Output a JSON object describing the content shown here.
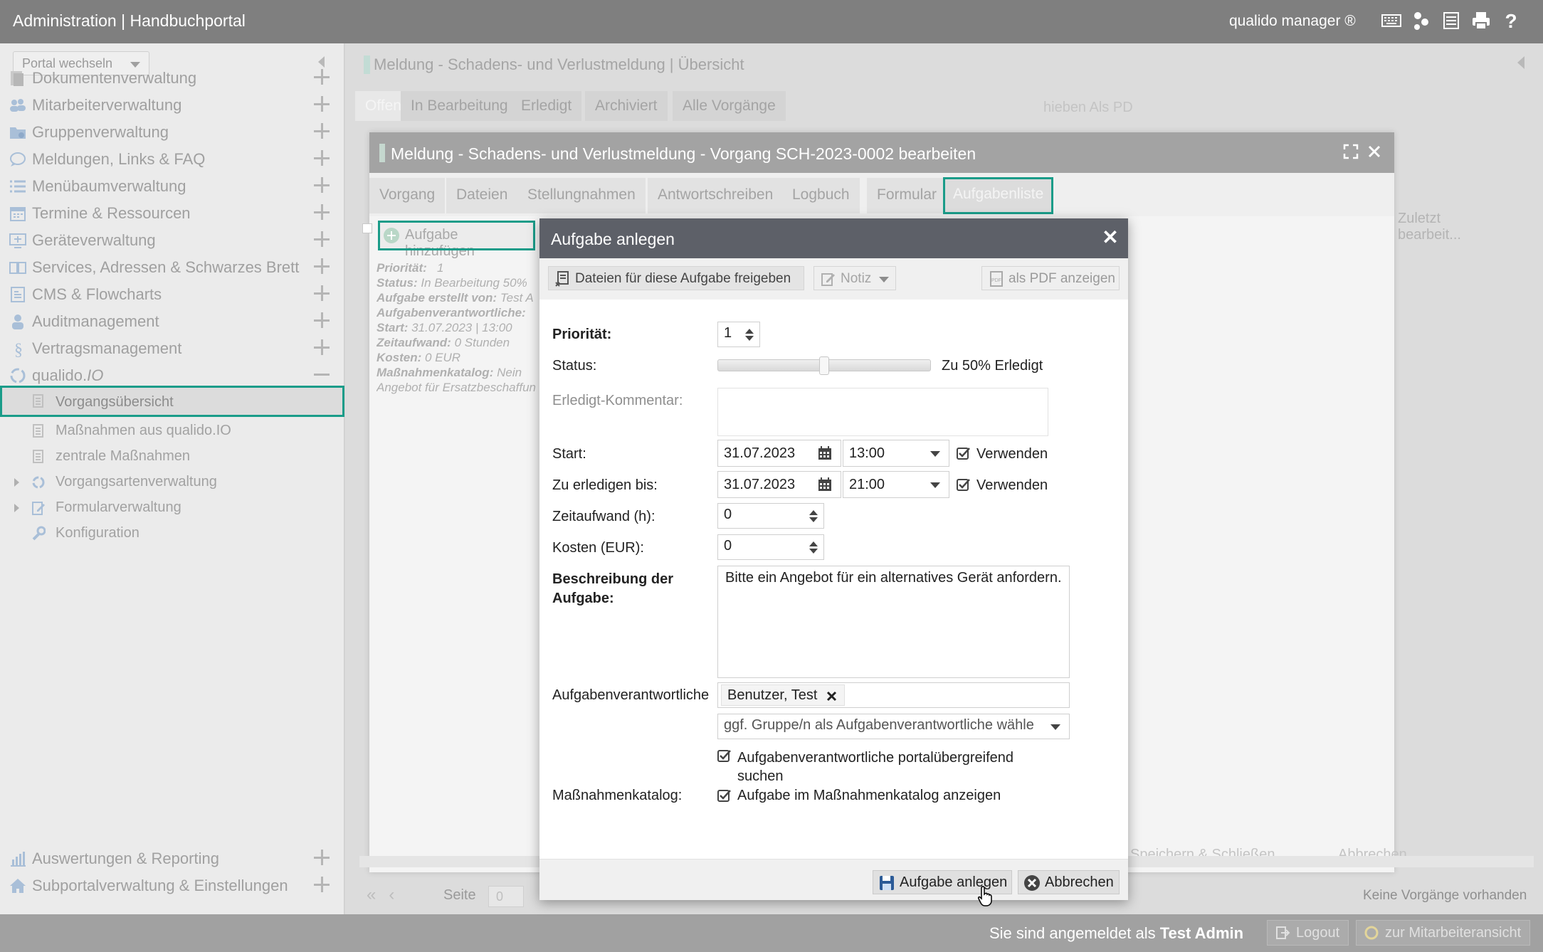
{
  "topbar": {
    "title": "Administration | Handbuchportal",
    "manager": "qualido manager ®",
    "icons": [
      "keyboard-icon",
      "hierarchy-icon",
      "document-stack-icon",
      "print-icon",
      "help-icon"
    ]
  },
  "sidebar": {
    "portal_select": "Portal wechseln",
    "items": [
      {
        "label": "Dokumentenverwaltung",
        "icon": "documents-icon"
      },
      {
        "label": "Mitarbeiterverwaltung",
        "icon": "users-icon"
      },
      {
        "label": "Gruppenverwaltung",
        "icon": "group-folder-icon"
      },
      {
        "label": "Meldungen, Links & FAQ",
        "icon": "speech-bubble-icon"
      },
      {
        "label": "Menübaumverwaltung",
        "icon": "list-icon"
      },
      {
        "label": "Termine & Ressourcen",
        "icon": "calendar-icon"
      },
      {
        "label": "Geräteverwaltung",
        "icon": "device-icon"
      },
      {
        "label": "Services, Adressen & Schwarzes Brett",
        "icon": "book-icon"
      },
      {
        "label": "CMS & Flowcharts",
        "icon": "cms-icon"
      },
      {
        "label": "Auditmanagement",
        "icon": "auditor-icon"
      },
      {
        "label": "Vertragsmanagement",
        "icon": "paragraph-icon"
      }
    ],
    "qualido_io": {
      "label_a": "qualido.",
      "label_b": "IO"
    },
    "sub_items": [
      {
        "label": "Vorgangsübersicht"
      },
      {
        "label": "Maßnahmen aus qualido.IO"
      },
      {
        "label": "zentrale Maßnahmen"
      },
      {
        "label": "Vorgangsartenverwaltung"
      },
      {
        "label": "Formularverwaltung"
      },
      {
        "label": "Konfiguration"
      }
    ],
    "bottom_items": [
      {
        "label": "Auswertungen & Reporting",
        "icon": "bar-chart-icon"
      },
      {
        "label": "Subportalverwaltung & Einstellungen",
        "icon": "home-icon"
      }
    ]
  },
  "main": {
    "title": "Meldung - Schadens- und Verlustmeldung | Übersicht",
    "tabs": [
      "Offen",
      "In Bearbeitung",
      "Erledigt",
      "Archiviert",
      "Alle Vorgänge"
    ],
    "bg_tools": "hieben     Als PD",
    "zuletzt": "Zuletzt bearbeit...",
    "save_close": "Speichern & Schließen",
    "cancel": "Abbrechen",
    "pager": {
      "seite": "Seite",
      "page_value": "0",
      "keine": "Keine Vorgänge vorhanden"
    }
  },
  "back_dialog": {
    "title": "Meldung - Schadens- und Verlustmeldung - Vorgang SCH-2023-0002 bearbeiten",
    "tabs": [
      "Vorgang",
      "Dateien",
      "Stellungnahmen",
      "Antwortschreiben",
      "Logbuch",
      "Formular",
      "Aufgabenliste"
    ],
    "add_task": "Aufgabe hinzufügen",
    "task_info": {
      "prio_l": "Priorität:",
      "prio_v": "1",
      "status_l": "Status:",
      "status_v": "In Bearbeitung   50%",
      "creator_l": "Aufgabe erstellt von:",
      "creator_v": "Test A",
      "resp_l": "Aufgabenverantwortliche:",
      "resp_v": "",
      "start_l": "Start:",
      "start_v": "31.07.2023 | 13:00",
      "effort_l": "Zeitaufwand:",
      "effort_v": "0 Stunden",
      "cost_l": "Kosten:",
      "cost_v": "0 EUR",
      "cat_l": "Maßnahmenkatalog:",
      "cat_v": "Nein",
      "desc_v": "Angebot für Ersatzbeschaffun"
    }
  },
  "dialog": {
    "title": "Aufgabe anlegen",
    "toolbar": {
      "share": "Dateien für diese Aufgabe freigeben",
      "notiz": "Notiz",
      "pdf": "als PDF anzeigen"
    },
    "fields": {
      "prio_label": "Priorität:",
      "prio_value": "1",
      "status_label": "Status:",
      "status_value": "Zu 50% Erledigt",
      "status_percent": 50,
      "comment_label": "Erledigt-Kommentar:",
      "comment_value": "",
      "start_label": "Start:",
      "start_date": "31.07.2023",
      "start_time": "13:00",
      "start_use": "Verwenden",
      "due_label": "Zu erledigen bis:",
      "due_date": "31.07.2023",
      "due_time": "21:00",
      "due_use": "Verwenden",
      "effort_label": "Zeitaufwand (h):",
      "effort_value": "0",
      "cost_label": "Kosten (EUR):",
      "cost_value": "0",
      "desc_label_1": "Beschreibung der",
      "desc_label_2": "Aufgabe:",
      "desc_value": "Bitte ein Angebot für ein alternatives Gerät anfordern.",
      "resp_label": "Aufgabenverantwortliche",
      "resp_tag": "Benutzer, Test",
      "group_placeholder": "ggf. Gruppe/n als Aufgabenverantwortliche wähle",
      "cross_portal_1": "Aufgabenverantwortliche portalübergreifend",
      "cross_portal_2": "suchen",
      "catalog_label": "Maßnahmenkatalog:",
      "catalog_check": "Aufgabe im Maßnahmenkatalog anzeigen"
    },
    "footer": {
      "create": "Aufgabe anlegen",
      "cancel": "Abbrechen"
    }
  },
  "footer": {
    "logged_in": "Sie sind angemeldet als",
    "user": "Test Admin",
    "logout": "Logout",
    "staff_view": "zur Mitarbeiteransicht"
  },
  "colors": {
    "accent": "#1a9c89",
    "dialog_header": "#5d6068",
    "topbar": "#7f7f7f"
  }
}
